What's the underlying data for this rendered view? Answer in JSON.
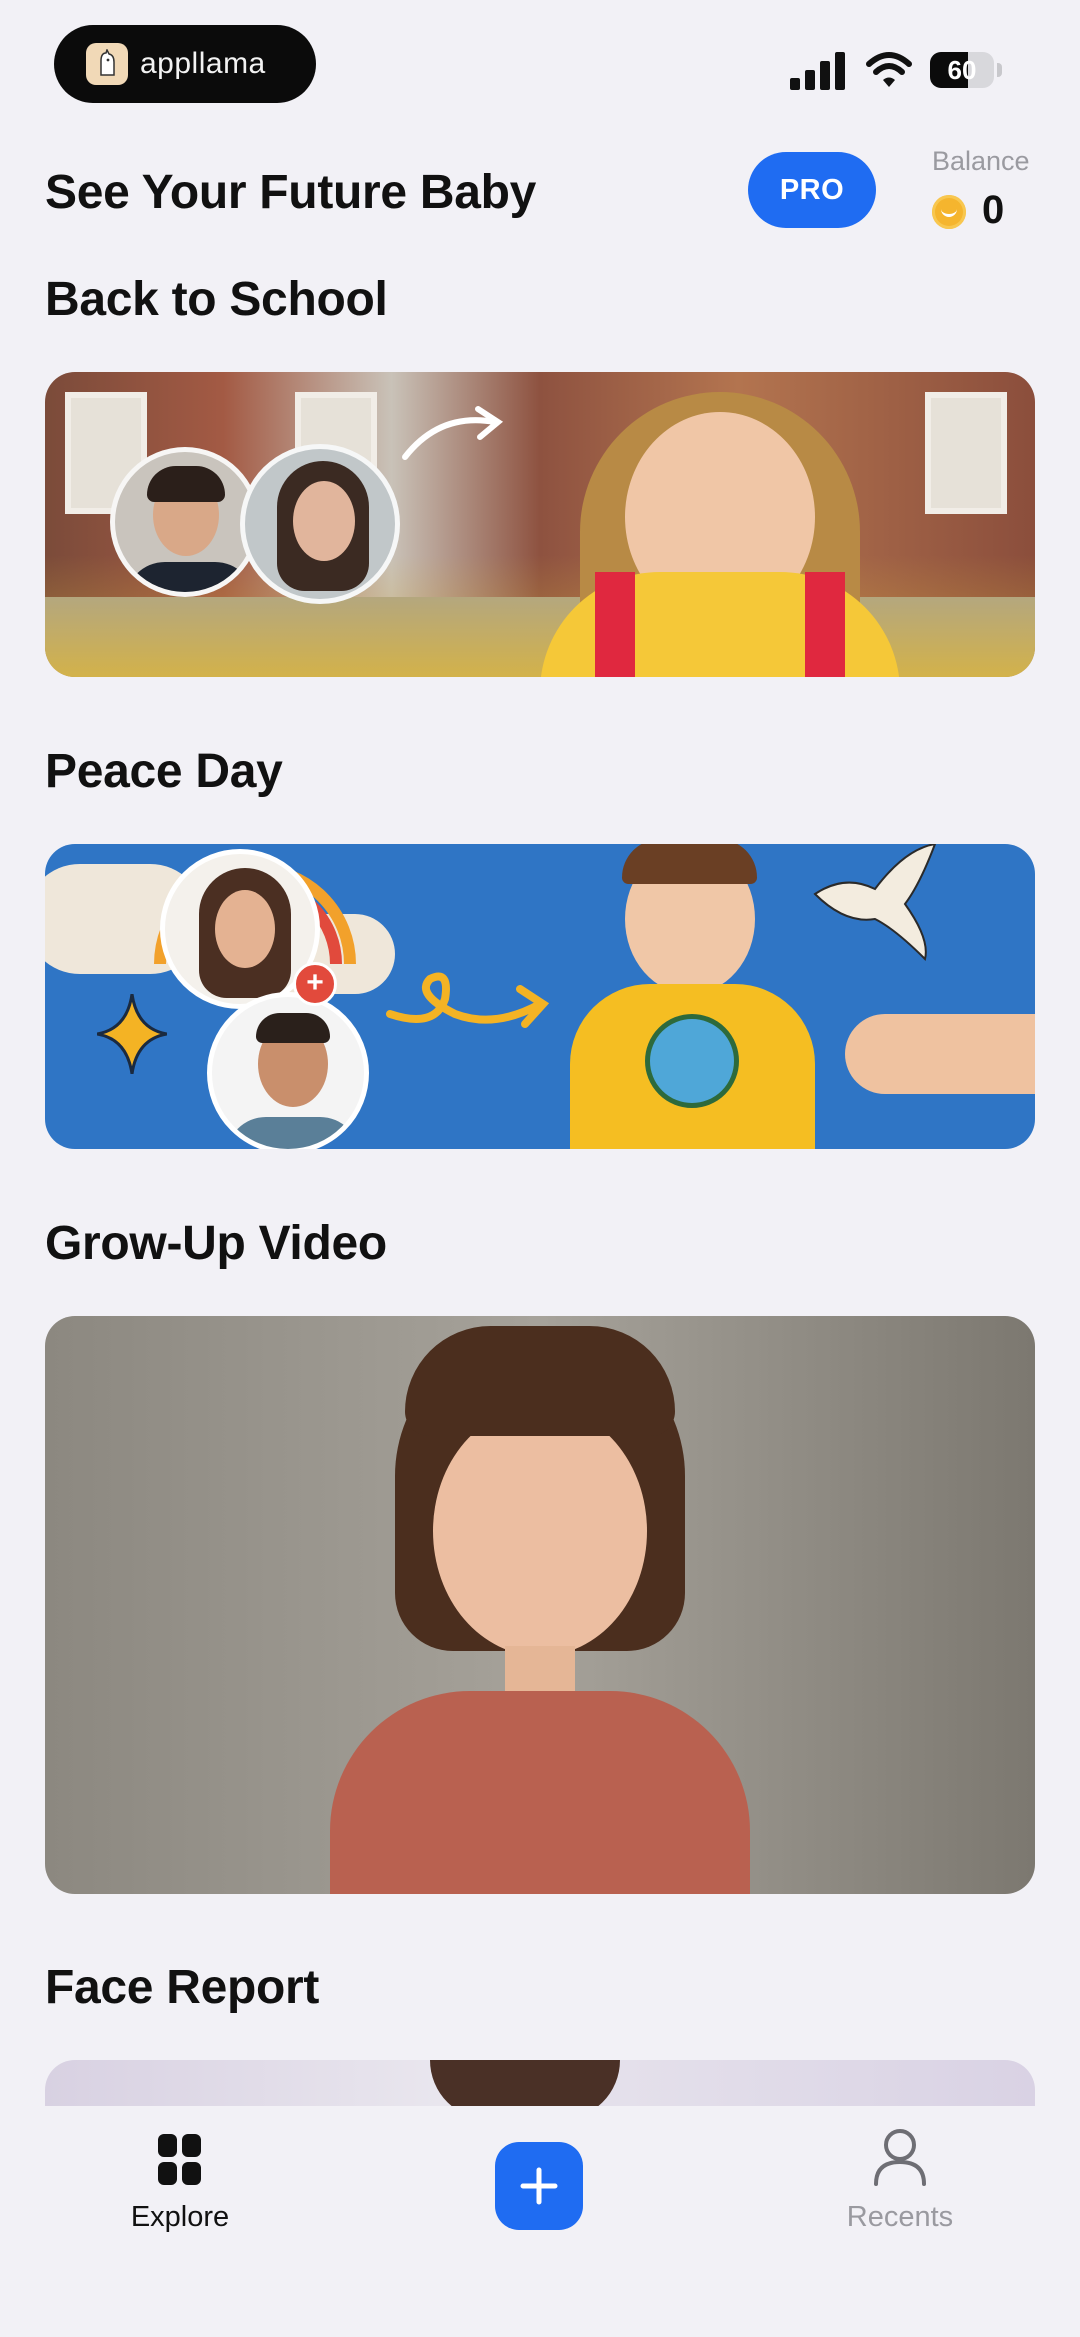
{
  "status_bar": {
    "app_name": "appllama",
    "battery_level": "60",
    "battery_fraction": 0.6
  },
  "header": {
    "title": "See Your Future Baby",
    "pro_label": "PRO",
    "balance_label": "Balance",
    "balance_value": "0"
  },
  "sections": [
    {
      "title": "Back to School"
    },
    {
      "title": "Peace Day"
    },
    {
      "title": "Grow-Up Video"
    },
    {
      "title": "Face Report"
    }
  ],
  "tab_bar": {
    "explore_label": "Explore",
    "recents_label": "Recents"
  },
  "colors": {
    "accent": "#1f6cf2",
    "background": "#f2f1f6",
    "inactive_tab": "#9a9aa0",
    "coin": "#f5b52e"
  },
  "icons": {
    "explore": "grid-icon",
    "add": "plus-icon",
    "recents": "person-icon",
    "coin": "coin-icon"
  }
}
